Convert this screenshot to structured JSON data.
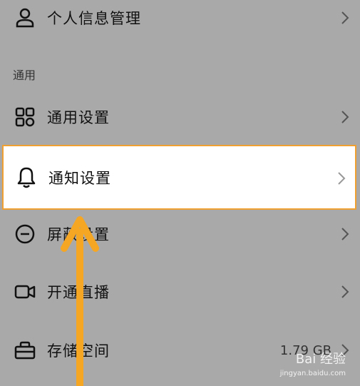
{
  "rows": {
    "personal_info": "个人信息管理",
    "general_settings": "通用设置",
    "notification_settings": "通知设置",
    "block_settings": "屏蔽设置",
    "start_live": "开通直播",
    "storage": "存储空间",
    "storage_value": "1.79 GB"
  },
  "section": {
    "general": "通用"
  },
  "watermark": {
    "brand": "Bai 经验",
    "url": "jingyan.baidu.com"
  },
  "colors": {
    "background": "#a9a9a9",
    "highlight_border": "#f0a030",
    "arrow": "#f5a623"
  }
}
